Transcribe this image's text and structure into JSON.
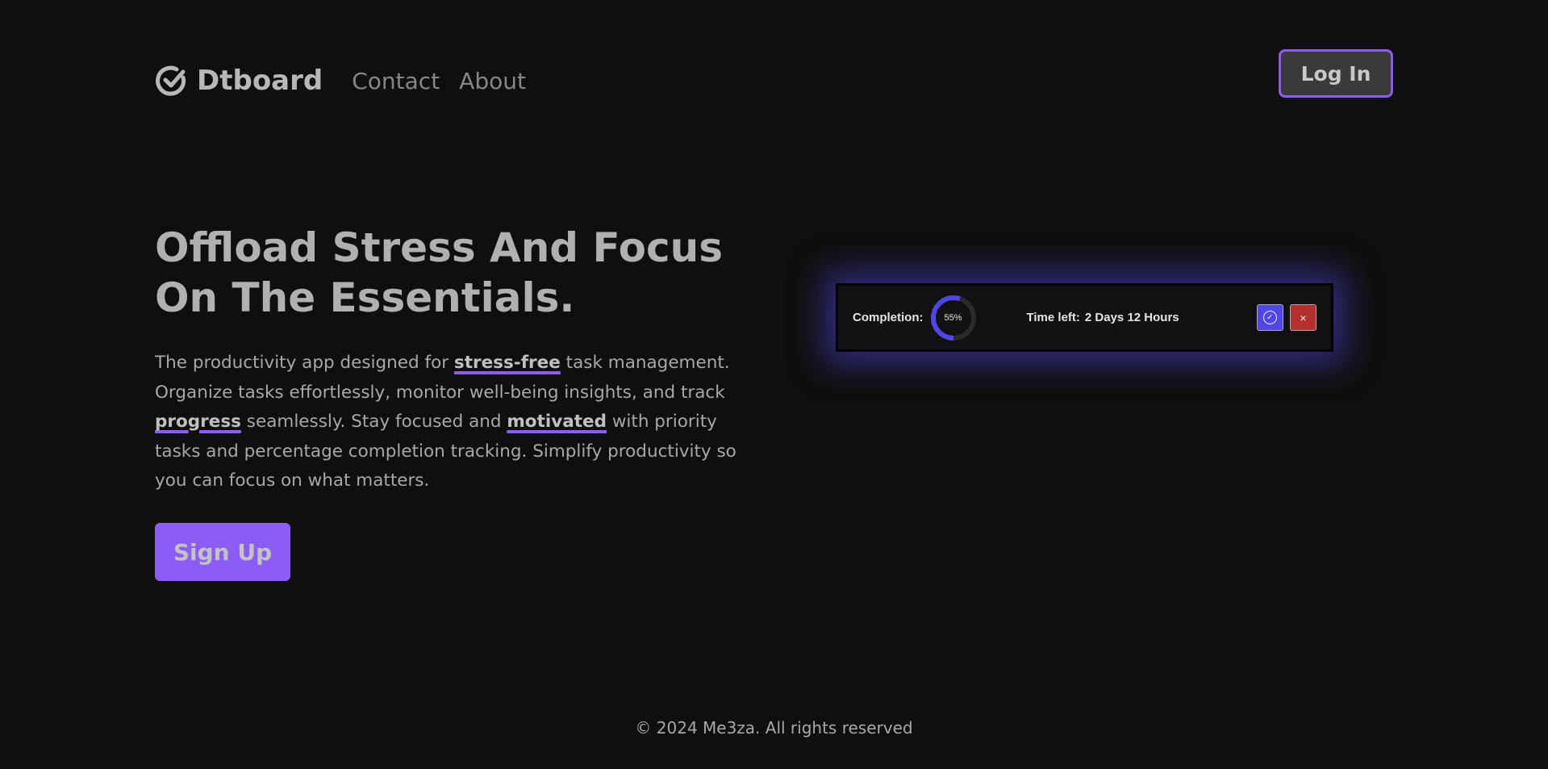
{
  "nav": {
    "brand": "Dtboard",
    "links": [
      "Contact",
      "About"
    ],
    "login": "Log In"
  },
  "hero": {
    "title": "Offload Stress And Focus On The Essentials.",
    "p1": "The productivity app designed for ",
    "k1": "stress-free",
    "p2": " task management. Organize tasks effortlessly, monitor well-being insights, and track ",
    "k2": "progress",
    "p3": " seamlessly. Stay focused and ",
    "k3": "motivated",
    "p4": " with priority tasks and percentage completion tracking. Simplify productivity so you can focus on what matters.",
    "signup": "Sign Up"
  },
  "card": {
    "completion_label": "Completion:",
    "completion_text": "55%",
    "completion_value": 55,
    "time_label": "Time left:",
    "time_value": "2 Days 12 Hours",
    "done": "✓",
    "delete": "×"
  },
  "colors": {
    "accent": "#8b5cf6",
    "ring": "#4f46e5",
    "delete": "#b3302e"
  },
  "footer": "© 2024 Me3za. All rights reserved"
}
